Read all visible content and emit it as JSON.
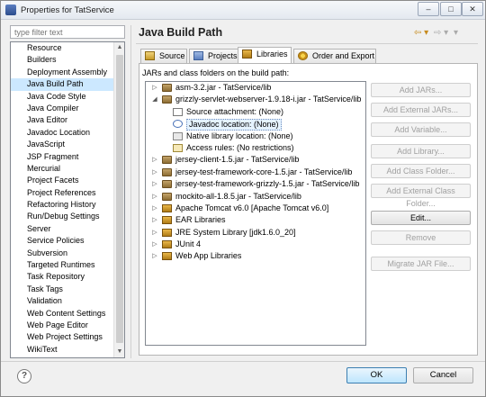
{
  "window": {
    "title": "Properties for TatService",
    "minimize": "–",
    "maximize": "□",
    "close": "✕"
  },
  "filter": {
    "placeholder": "type filter text"
  },
  "sidebar": {
    "items": [
      "Resource",
      "Builders",
      "Deployment Assembly",
      "Java Build Path",
      "Java Code Style",
      "Java Compiler",
      "Java Editor",
      "Javadoc Location",
      "JavaScript",
      "JSP Fragment",
      "Mercurial",
      "Project Facets",
      "Project References",
      "Refactoring History",
      "Run/Debug Settings",
      "Server",
      "Service Policies",
      "Subversion",
      "Targeted Runtimes",
      "Task Repository",
      "Task Tags",
      "Validation",
      "Web Content Settings",
      "Web Page Editor",
      "Web Project Settings",
      "WikiText"
    ],
    "selected_index": 3
  },
  "main": {
    "title": "Java Build Path",
    "back_arrow": "⇦ ▾",
    "forward_arrow": "⇨ ▾",
    "menu_arrow": "▾",
    "tabs": [
      {
        "label": "Source",
        "icon": "source-folder-icon"
      },
      {
        "label": "Projects",
        "icon": "projects-icon"
      },
      {
        "label": "Libraries",
        "icon": "libraries-icon"
      },
      {
        "label": "Order and Export",
        "icon": "order-export-icon"
      }
    ],
    "active_tab": "Libraries",
    "jars_label": "JARs and class folders on the build path:"
  },
  "tree": [
    {
      "label": "asm-3.2.jar - TatService/lib",
      "twisty": "▷",
      "icon": "jar-icon",
      "level": 0
    },
    {
      "label": "grizzly-servlet-webserver-1.9.18-i.jar - TatService/lib",
      "twisty": "◢",
      "icon": "jar-icon",
      "level": 0
    },
    {
      "label": "Source attachment: (None)",
      "twisty": "",
      "icon": "source-attachment-icon",
      "level": 1
    },
    {
      "label": "Javadoc location: (None)",
      "twisty": "",
      "icon": "javadoc-icon",
      "level": 1,
      "selected": true
    },
    {
      "label": "Native library location: (None)",
      "twisty": "",
      "icon": "native-library-icon",
      "level": 1
    },
    {
      "label": "Access rules: (No restrictions)",
      "twisty": "",
      "icon": "access-rules-icon",
      "level": 1
    },
    {
      "label": "jersey-client-1.5.jar - TatService/lib",
      "twisty": "▷",
      "icon": "jar-icon",
      "level": 0
    },
    {
      "label": "jersey-test-framework-core-1.5.jar - TatService/lib",
      "twisty": "▷",
      "icon": "jar-icon",
      "level": 0
    },
    {
      "label": "jersey-test-framework-grizzly-1.5.jar - TatService/lib",
      "twisty": "▷",
      "icon": "jar-icon",
      "level": 0
    },
    {
      "label": "mockito-all-1.8.5.jar - TatService/lib",
      "twisty": "▷",
      "icon": "jar-icon",
      "level": 0
    },
    {
      "label": "Apache Tomcat v6.0 [Apache Tomcat v6.0]",
      "twisty": "▷",
      "icon": "library-icon",
      "level": 0
    },
    {
      "label": "EAR Libraries",
      "twisty": "▷",
      "icon": "library-icon",
      "level": 0
    },
    {
      "label": "JRE System Library [jdk1.6.0_20]",
      "twisty": "▷",
      "icon": "library-icon",
      "level": 0
    },
    {
      "label": "JUnit 4",
      "twisty": "▷",
      "icon": "library-icon",
      "level": 0
    },
    {
      "label": "Web App Libraries",
      "twisty": "▷",
      "icon": "library-icon",
      "level": 0
    }
  ],
  "buttons": {
    "add_jars": "Add JARs...",
    "add_external_jars": "Add External JARs...",
    "add_variable": "Add Variable...",
    "add_library": "Add Library...",
    "add_class_folder": "Add Class Folder...",
    "add_external_class_folder": "Add External Class Folder...",
    "edit": "Edit...",
    "remove": "Remove",
    "migrate_jar": "Migrate JAR File..."
  },
  "footer": {
    "help": "?",
    "ok": "OK",
    "cancel": "Cancel"
  },
  "colors": {
    "selection": "#cce8ff",
    "ok_border": "#3c7fb1",
    "disabled_text": "#a0a0a0"
  }
}
